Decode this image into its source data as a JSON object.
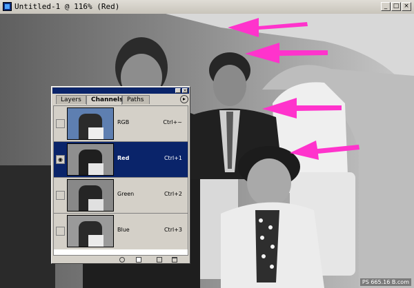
{
  "window": {
    "title": "Untitled-1 @ 116% (Red)",
    "min_glyph": "_",
    "max_glyph": "□",
    "close_glyph": "×"
  },
  "palette": {
    "close_glyph": "×",
    "tabs": [
      {
        "label": "Layers",
        "active": false
      },
      {
        "label": "Channels",
        "active": true
      },
      {
        "label": "Paths",
        "active": false
      }
    ],
    "menu_glyph": "▸",
    "channels": [
      {
        "name": "RGB",
        "shortcut": "Ctrl+~",
        "visible": false,
        "selected": false
      },
      {
        "name": "Red",
        "shortcut": "Ctrl+1",
        "visible": true,
        "selected": true
      },
      {
        "name": "Green",
        "shortcut": "Ctrl+2",
        "visible": false,
        "selected": false
      },
      {
        "name": "Blue",
        "shortcut": "Ctrl+3",
        "visible": false,
        "selected": false
      }
    ],
    "eye_glyph": "◉"
  },
  "watermark": "PS 665.16   B.com",
  "colors": {
    "arrow": "#ff33cc",
    "selection": "#0a246a",
    "titlebar": "#0a246a"
  }
}
